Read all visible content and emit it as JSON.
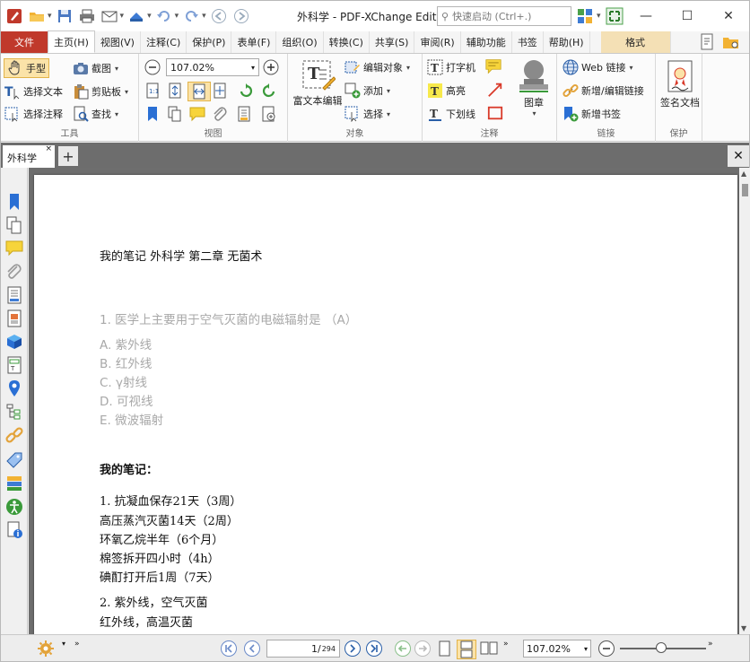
{
  "window": {
    "title": "外科学 - PDF-XChange Editor",
    "quick_launch_placeholder": "快速启动 (Ctrl+.)",
    "controls": [
      "—",
      "☐",
      "✕"
    ]
  },
  "ribbon_tabs": [
    {
      "label": "文件"
    },
    {
      "label": "主页(H)"
    },
    {
      "label": "视图(V)"
    },
    {
      "label": "注释(C)"
    },
    {
      "label": "保护(P)"
    },
    {
      "label": "表单(F)"
    },
    {
      "label": "组织(O)"
    },
    {
      "label": "转换(C)"
    },
    {
      "label": "共享(S)"
    },
    {
      "label": "审阅(R)"
    },
    {
      "label": "辅助功能"
    },
    {
      "label": "书签"
    },
    {
      "label": "帮助(H)"
    },
    {
      "label": "格式"
    }
  ],
  "ribbon": {
    "tools": {
      "label": "工具",
      "hand": "手型",
      "snapshot": "截图",
      "select_text": "选择文本",
      "clipboard": "剪贴板",
      "select_annot": "选择注释",
      "find": "查找"
    },
    "view": {
      "label": "视图",
      "zoom": "107.02%"
    },
    "objects": {
      "label": "对象",
      "rich_text": "富文本编辑",
      "edit_object": "编辑对象",
      "add": "添加",
      "select": "选择"
    },
    "comments": {
      "label": "注释",
      "typewriter": "打字机",
      "highlight": "高亮",
      "underline": "下划线",
      "stamp": "图章"
    },
    "links": {
      "label": "链接",
      "web_links": "Web 链接",
      "add_edit_link": "新增/编辑链接",
      "add_bookmark": "新增书签"
    },
    "protect": {
      "label": "保护",
      "sign": "签名文档"
    }
  },
  "document_tab": {
    "label": "外科学",
    "close": "×"
  },
  "document": {
    "lines": [
      {
        "text": "我的笔记 外科学 第二章 无菌术",
        "style": "normal"
      },
      {
        "text": "1. 医学上主要用于空气灭菌的电磁辐射是 （A）",
        "style": "q"
      },
      {
        "text": "A. 紫外线",
        "style": "q"
      },
      {
        "text": "B. 红外线",
        "style": "q"
      },
      {
        "text": "C. γ射线",
        "style": "q"
      },
      {
        "text": "D. 可视线",
        "style": "q"
      },
      {
        "text": "E. 微波辐射",
        "style": "q"
      },
      {
        "text": "我的笔记：",
        "style": "b"
      },
      {
        "text": "1.  抗凝血保存21天（3周）",
        "style": "normal"
      },
      {
        "text": "高压蒸汽灭菌14天（2周）",
        "style": "normal"
      },
      {
        "text": "环氧乙烷半年（6个月）",
        "style": "normal"
      },
      {
        "text": "棉签拆开四小时（4h）",
        "style": "normal"
      },
      {
        "text": "碘酊打开后1周（7天）",
        "style": "normal"
      },
      {
        "text": "2.  紫外线，空气灭菌",
        "style": "normal"
      },
      {
        "text": "红外线，高温灭菌",
        "style": "normal"
      }
    ]
  },
  "status_bar": {
    "page_current": "1",
    "page_total": "294",
    "zoom": "107.02%"
  },
  "colors": {
    "file_tab": "#c0392b",
    "format_tab": "#f4e0b5",
    "viewer_bg": "#6e6e6e",
    "question_text": "#a8a8a8"
  }
}
